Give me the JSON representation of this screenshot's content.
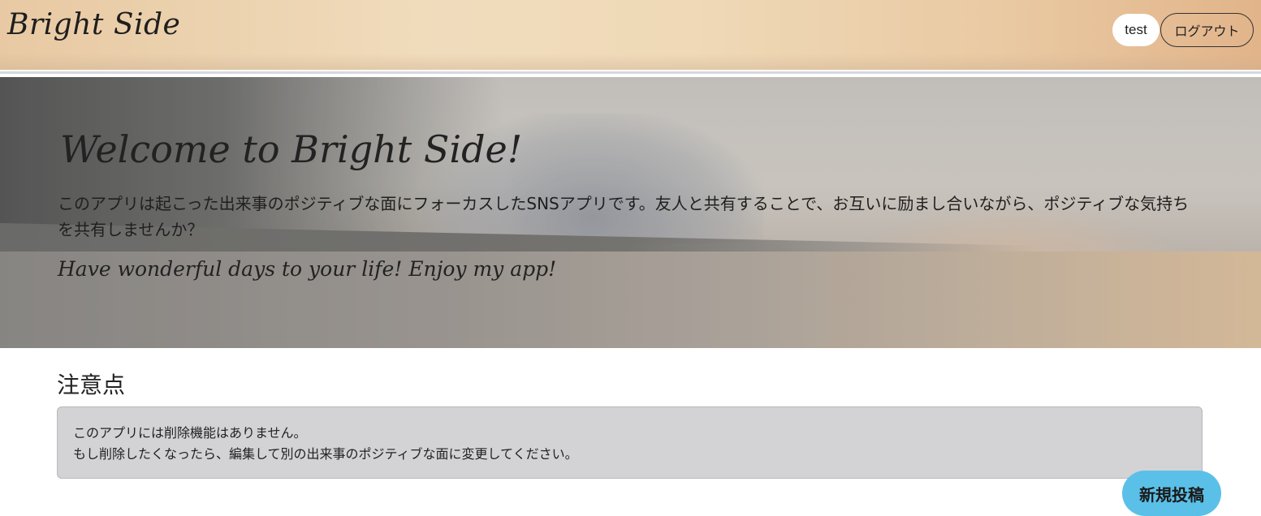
{
  "header": {
    "brand": "Bright Side",
    "username": "test",
    "logout_label": "ログアウト"
  },
  "hero": {
    "title": "Welcome to Bright Side!",
    "description": "このアプリは起こった出来事のポジティブな面にフォーカスしたSNSアプリです。友人と共有することで、お互いに励まし合いながら、ポジティブな気持ちを共有しませんか？",
    "tagline": "Have wonderful days to your life! Enjoy my app!"
  },
  "notes": {
    "heading": "注意点",
    "lines": [
      "このアプリには削除機能はありません。",
      "もし削除したくなったら、編集して別の出来事のポジティブな面に変更してください。"
    ]
  },
  "fab": {
    "label": "新規投稿",
    "color": "#5bc0e8"
  }
}
